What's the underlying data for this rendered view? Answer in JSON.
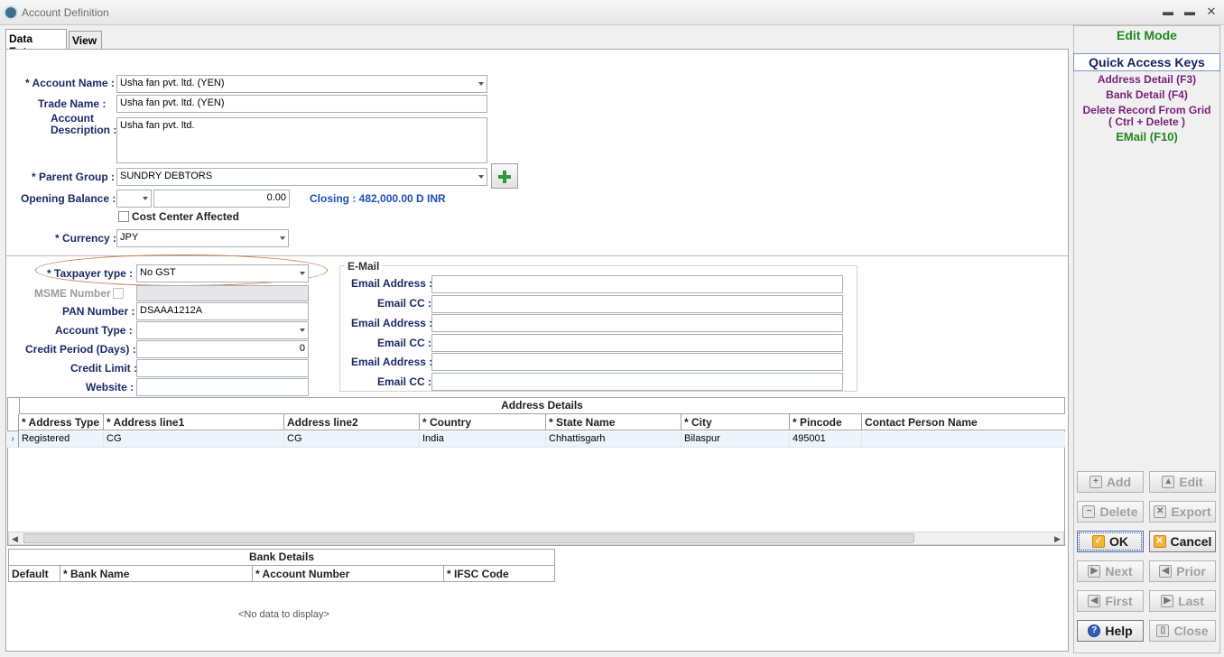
{
  "window": {
    "title": "Account Definition",
    "minimize": "▬",
    "maximize": "▬",
    "close": "✕"
  },
  "tabs": [
    {
      "label": "Data Entry"
    },
    {
      "label": "View"
    }
  ],
  "form": {
    "account_name_label": "* Account Name :",
    "account_name_value": "Usha fan pvt. ltd. (YEN)",
    "trade_name_label": "Trade Name :",
    "trade_name_value": "Usha fan pvt. ltd. (YEN)",
    "account_desc_label_1": "Account",
    "account_desc_label_2": "Description :",
    "account_desc_value": "Usha fan pvt. ltd.",
    "parent_group_label": "* Parent Group :",
    "parent_group_value": "SUNDRY DEBTORS",
    "opening_balance_label": "Opening Balance :",
    "opening_balance_value": "0.00",
    "closing_text": "Closing : 482,000.00 D INR",
    "cost_center_label": "Cost Center Affected",
    "currency_label": "* Currency :",
    "currency_value": "JPY",
    "taxpayer_type_label": "* Taxpayer type :",
    "taxpayer_type_value": "No GST",
    "msme_label": "MSME Number",
    "pan_label": "PAN Number :",
    "pan_value": "DSAAA1212A",
    "account_type_label": "Account Type :",
    "credit_period_label": "Credit Period (Days) :",
    "credit_period_value": "0",
    "credit_limit_label": "Credit Limit :",
    "website_label": "Website :"
  },
  "email": {
    "legend": "E-Mail",
    "rows": [
      {
        "label": "Email Address :"
      },
      {
        "label": "Email CC :"
      },
      {
        "label": "Email Address :"
      },
      {
        "label": "Email CC :"
      },
      {
        "label": "Email Address :"
      },
      {
        "label": "Email CC :"
      }
    ]
  },
  "address_grid": {
    "title": "Address Details",
    "columns": [
      "* Address Type",
      "* Address line1",
      "Address line2",
      "* Country",
      "* State Name",
      "* City",
      "* Pincode",
      "Contact Person Name"
    ],
    "rows": [
      [
        "Registered",
        "CG",
        "CG",
        "India",
        "Chhattisgarh",
        "Bilaspur",
        "495001",
        ""
      ]
    ]
  },
  "bank_grid": {
    "title": "Bank Details",
    "columns": [
      "Default",
      "* Bank Name",
      "* Account Number",
      "* IFSC Code"
    ],
    "empty_text": "<No data to display>"
  },
  "right_panel": {
    "mode": "Edit Mode",
    "quick_access_title": "Quick Access Keys",
    "keys": [
      "Address Detail (F3)",
      "Bank Detail (F4)",
      "Delete Record From Grid",
      "( Ctrl + Delete )",
      "EMail (F10)"
    ],
    "buttons": {
      "add": "Add",
      "edit": "Edit",
      "delete": "Delete",
      "export": "Export",
      "ok": "OK",
      "cancel": "Cancel",
      "next": "Next",
      "prior": "Prior",
      "first": "First",
      "last": "Last",
      "help": "Help",
      "close": "Close"
    }
  },
  "colors": {
    "label": "#1c2a66",
    "closing": "#1b4fb5",
    "edit_mode": "#1e8a1e",
    "quick_keys": "#7a1f7a",
    "oval": "#c67b4f"
  }
}
